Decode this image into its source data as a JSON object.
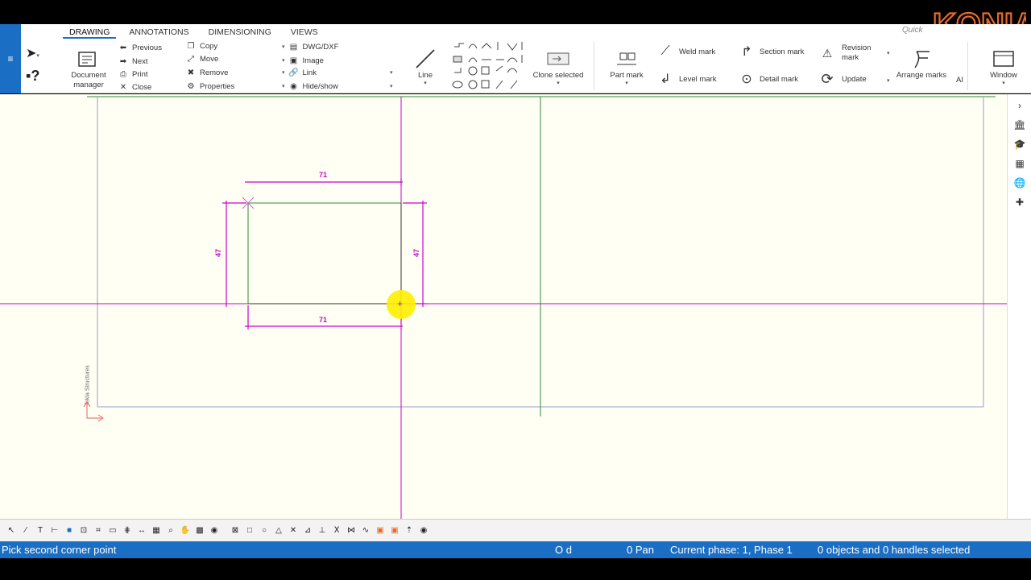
{
  "app": {
    "quick_launch_placeholder": "Quick",
    "brand": "KONIA"
  },
  "tabs": [
    {
      "label": "DRAWING",
      "active": true
    },
    {
      "label": "ANNOTATIONS",
      "active": false
    },
    {
      "label": "DIMENSIONING",
      "active": false
    },
    {
      "label": "VIEWS",
      "active": false
    }
  ],
  "ribbon": {
    "document_manager": "Document manager",
    "nav": {
      "previous": "Previous",
      "next": "Next",
      "print": "Print",
      "close": "Close"
    },
    "edit": {
      "copy": "Copy",
      "move": "Move",
      "remove": "Remove",
      "properties": "Properties"
    },
    "insert": {
      "dwg": "DWG/DXF",
      "image": "Image",
      "link": "Link",
      "hide_show": "Hide/show"
    },
    "line": "Line",
    "clone_selected": "Clone selected",
    "part_mark": "Part mark",
    "weld_mark": "Weld mark",
    "level_mark": "Level mark",
    "section_mark": "Section mark",
    "detail_mark": "Detail mark",
    "revision_mark": "Revision mark",
    "update": "Update",
    "arrange_marks": "Arrange marks",
    "ai": "AI",
    "window": "Window"
  },
  "drawing": {
    "dim_top": "71",
    "dim_bottom": "71",
    "dim_left": "47",
    "dim_right": "47",
    "watermark": "Tekla Structures"
  },
  "status": {
    "prompt": "Pick second corner point",
    "od": "O d",
    "pan": "0  Pan",
    "phase": "Current phase: 1, Phase 1",
    "selection": "0 objects and 0 handles selected"
  },
  "colors": {
    "accent": "#1a6fc4",
    "dimension": "#cc00cc",
    "grid_green": "#2e8b3a",
    "highlight": "#ffee00",
    "brand": "#e86a2a"
  }
}
